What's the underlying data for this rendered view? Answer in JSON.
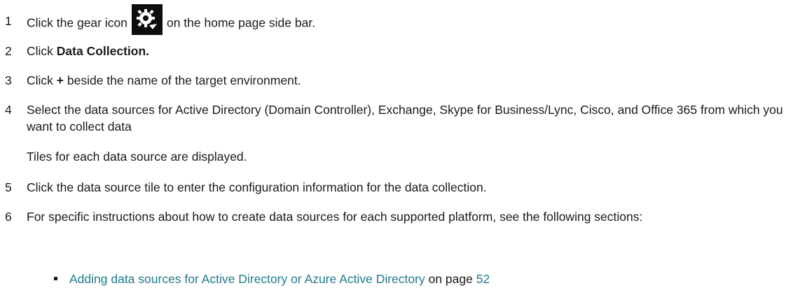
{
  "steps": [
    {
      "num": "1",
      "text_before": "Click the gear icon",
      "icon": "gear-icon",
      "text_after": "on the home page side bar."
    },
    {
      "num": "2",
      "text_before": "Click ",
      "bold": "Data Collection."
    },
    {
      "num": "3",
      "text_before": "Click ",
      "bold": "+",
      "text_after": " beside the name of the target environment."
    },
    {
      "num": "4",
      "text": "Select the data sources for Active Directory (Domain Controller), Exchange, Skype for Business/Lync, Cisco, and Office 365 from which you want to collect data",
      "note": "Tiles for each data source are displayed."
    },
    {
      "num": "5",
      "text": "Click the data source tile to enter the configuration information for the data collection."
    },
    {
      "num": "6",
      "text": "For specific instructions about how to create data sources for each supported platform, see the following sections:"
    }
  ],
  "bullets": [
    {
      "link_text": "Adding data sources for Active Directory or Azure Active Directory",
      "middle": " on page ",
      "page": "52"
    }
  ],
  "colors": {
    "link": "#1f7a8c",
    "text": "#1a1a1a",
    "icon_tile": "#0d0d0d"
  }
}
